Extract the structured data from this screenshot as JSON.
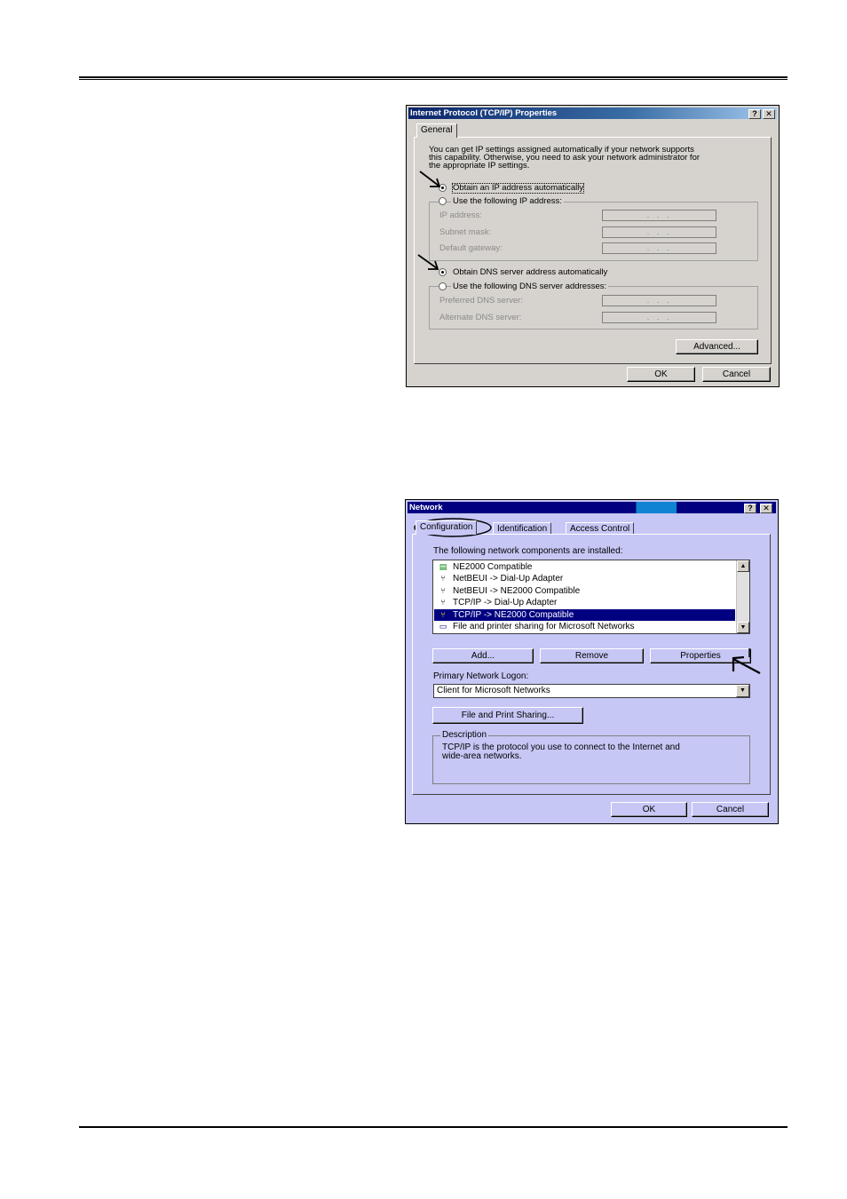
{
  "tcp_dialog": {
    "title": "Internet Protocol (TCP/IP) Properties",
    "help_icon": "help-question-icon",
    "close_icon": "close-x-icon",
    "tab_general": "General",
    "intro_lines": [
      "You can get IP settings assigned automatically if your network supports",
      "this capability. Otherwise, you need to ask your network administrator for",
      "the appropriate IP settings."
    ],
    "radio_obtain_ip": "Obtain an IP address automatically",
    "radio_use_ip": "Use the following IP address:",
    "ip_address_label": "IP address:",
    "subnet_mask_label": "Subnet mask:",
    "default_gateway_label": "Default gateway:",
    "ip_placeholder": ". . .",
    "radio_obtain_dns": "Obtain DNS server address automatically",
    "radio_use_dns": "Use the following DNS server addresses:",
    "preferred_dns_label": "Preferred DNS server:",
    "alternate_dns_label": "Alternate DNS server:",
    "advanced_button": "Advanced...",
    "ok_button": "OK",
    "cancel_button": "Cancel"
  },
  "network_dialog": {
    "title": "Network",
    "tabs": [
      "Configuration",
      "Identification",
      "Access Control"
    ],
    "components_label": "The following network components are installed:",
    "components": [
      {
        "label": "NE2000 Compatible",
        "icon": "network-adapter-icon",
        "selected": false
      },
      {
        "label": "NetBEUI -> Dial-Up Adapter",
        "icon": "protocol-icon",
        "selected": false
      },
      {
        "label": "NetBEUI -> NE2000 Compatible",
        "icon": "protocol-icon",
        "selected": false
      },
      {
        "label": "TCP/IP -> Dial-Up Adapter",
        "icon": "protocol-icon",
        "selected": false
      },
      {
        "label": "TCP/IP -> NE2000 Compatible",
        "icon": "protocol-icon",
        "selected": true
      },
      {
        "label": "File and printer sharing for Microsoft Networks",
        "icon": "service-icon",
        "selected": false
      }
    ],
    "add_button": "Add...",
    "remove_button": "Remove",
    "properties_button": "Properties",
    "primary_logon_label": "Primary Network Logon:",
    "primary_logon_value": "Client for Microsoft Networks",
    "file_print_sharing_button": "File and Print Sharing...",
    "description_legend": "Description",
    "description_lines": [
      "TCP/IP is the protocol you use to connect to the Internet and",
      "wide-area networks."
    ],
    "ok_button": "OK",
    "cancel_button": "Cancel"
  },
  "colors": {
    "tcp_dialog_bg": "#d6d3ce",
    "network_dialog_bg": "#c6c7f5",
    "selection": "#000080"
  }
}
